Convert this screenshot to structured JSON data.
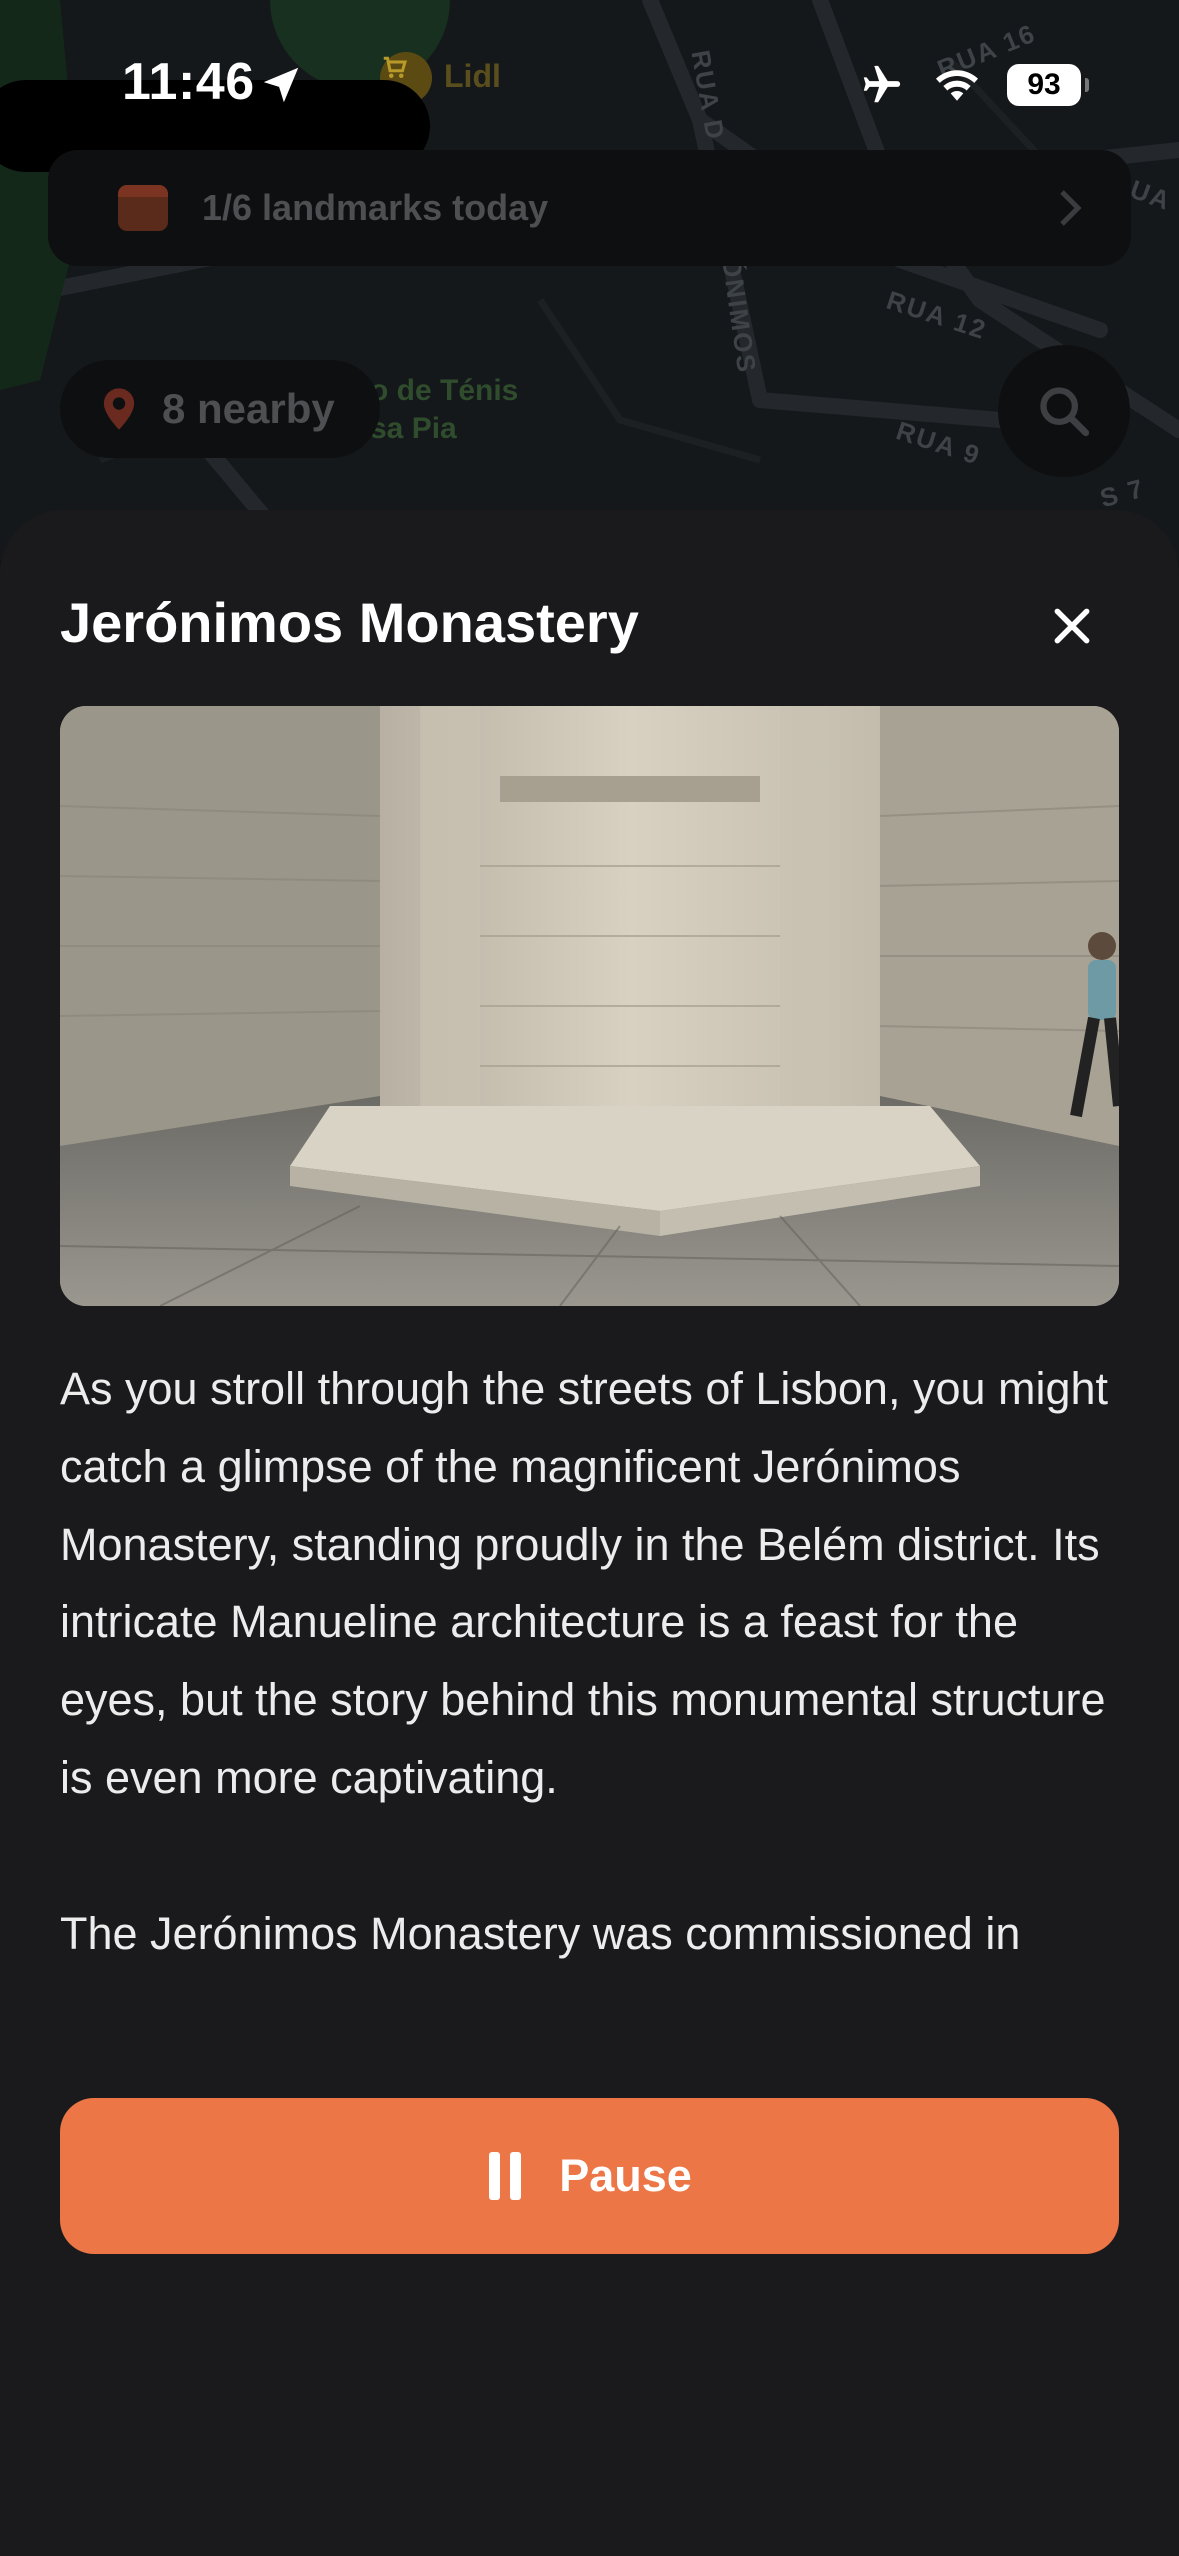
{
  "status_bar": {
    "time": "11:46",
    "battery": "93",
    "icons": [
      "location-arrow-icon",
      "airplane-icon",
      "wifi-icon",
      "battery-icon"
    ]
  },
  "map": {
    "poi": "Lidl",
    "streets": [
      "RUA 16",
      "RUA D",
      "ÓNIMOS",
      "RUA 12",
      "RUA 9",
      "UA",
      "S 7"
    ],
    "tennis_label_1": "o de Ténis",
    "tennis_label_2": "sa Pia",
    "landmarks_progress": "1/6 landmarks today",
    "nearby": "8 nearby"
  },
  "sheet": {
    "title": "Jerónimos Monastery",
    "paragraphs": [
      "As you stroll through the streets of Lisbon, you might catch a glimpse of the magnificent Jerónimos Monastery, standing proudly in the Belém district. Its intricate Manueline architecture is a feast for the eyes, but the story behind this monumental structure is even more captivating.",
      "The Jerónimos Monastery was commissioned in"
    ],
    "pause_label": "Pause"
  },
  "colors": {
    "accent": "#ec7646",
    "sheet_bg": "#1a1a1c",
    "map_bg": "#15181b"
  }
}
